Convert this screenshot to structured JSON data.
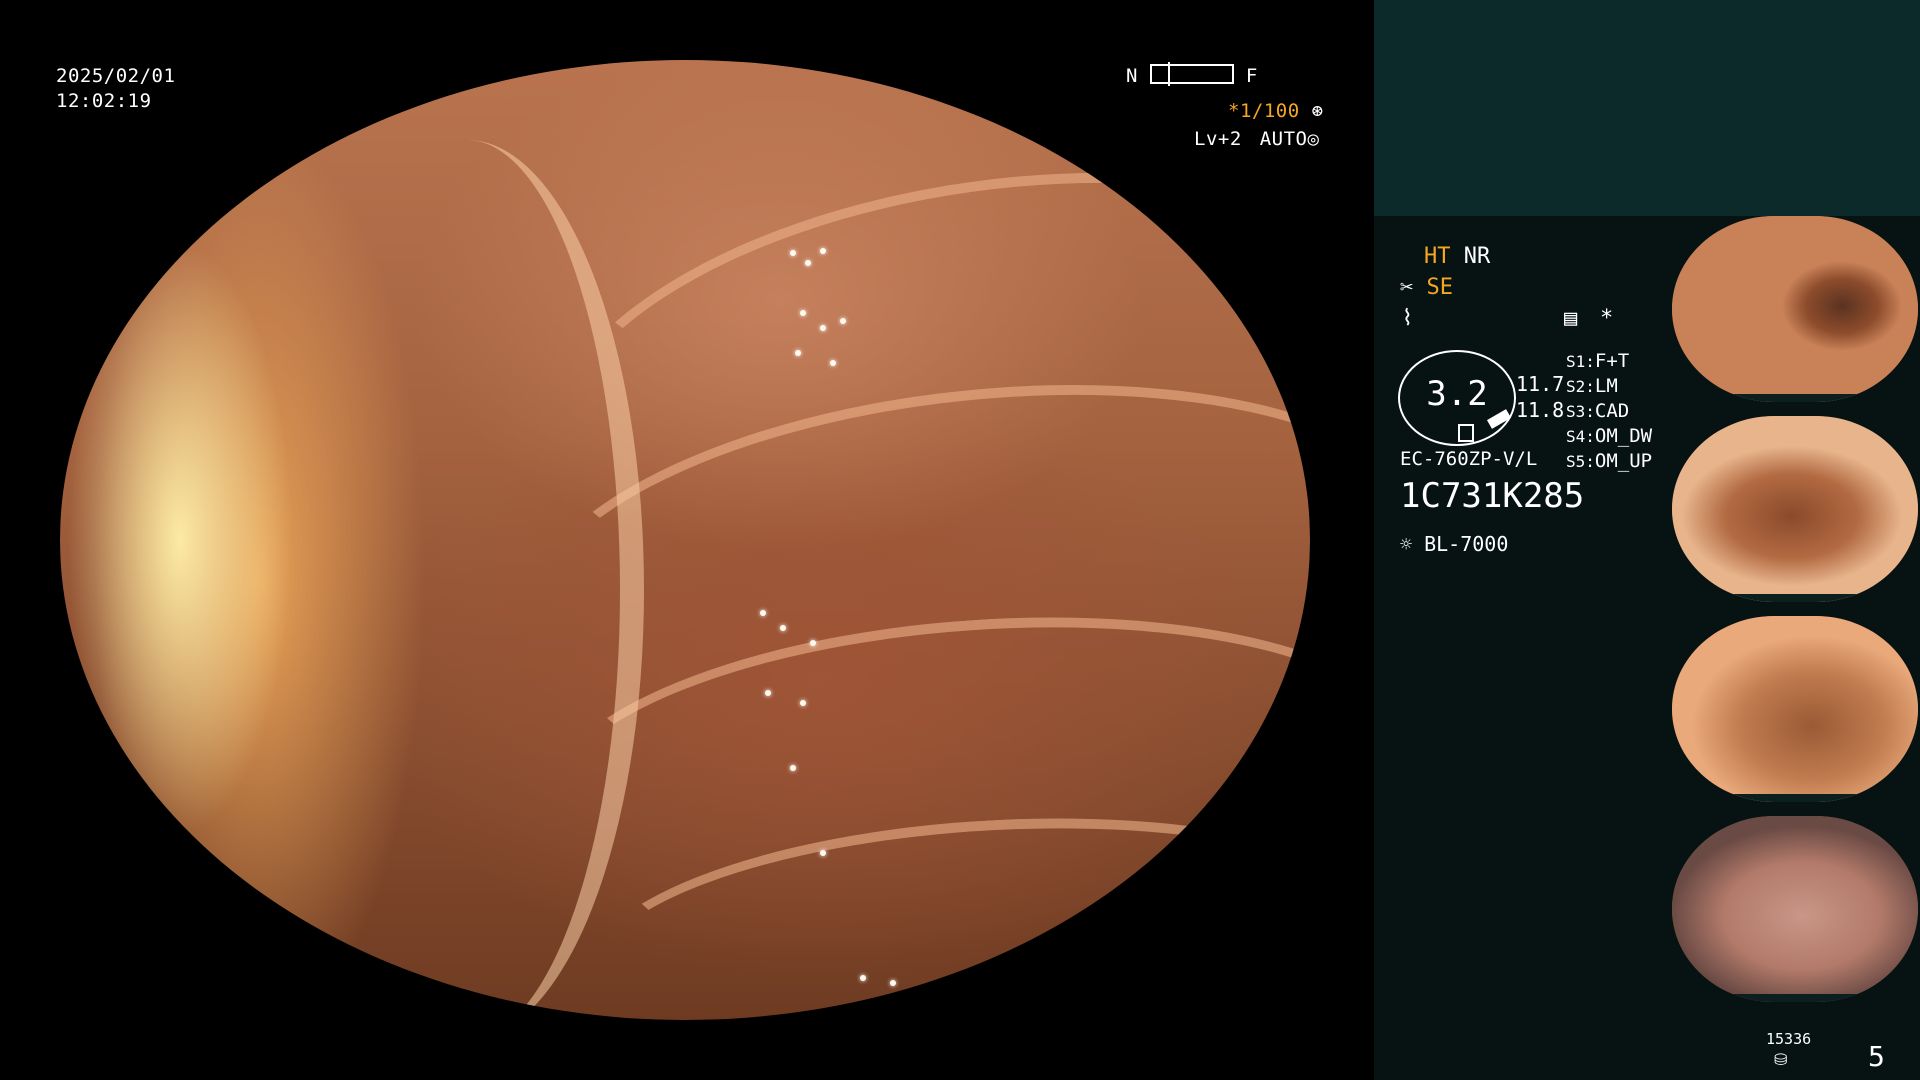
{
  "overlay": {
    "date": "2025/02/01",
    "time": "12:02:19",
    "near_label": "N",
    "far_label": "F",
    "shutter": "*1/100",
    "level": "Lv+2",
    "iris": "AUTO"
  },
  "panel": {
    "ht": "HT",
    "nr": "NR",
    "se": "SE",
    "asterisk": "*",
    "dial_value": "3.2",
    "value_1": "11.7",
    "value_2": "11.8",
    "switches": [
      {
        "key": "S1",
        "value": "F+T"
      },
      {
        "key": "S2",
        "value": "LM"
      },
      {
        "key": "S3",
        "value": "CAD"
      },
      {
        "key": "S4",
        "value": "OM_DW"
      },
      {
        "key": "S5",
        "value": "OM_UP"
      }
    ],
    "scope_model": "EC-760ZP-V/L",
    "serial": "1C731K285",
    "light_source": "BL-7000",
    "storage_count": "15336",
    "image_count": "5"
  },
  "colors": {
    "accent": "#f5a623",
    "panel_top": "#0b2a29",
    "panel_bg": "#071313"
  },
  "icons": [
    "shutter-icon",
    "iris-icon",
    "scissors-icon",
    "tilde-icon",
    "memo-icon",
    "light-icon",
    "disk-icon"
  ]
}
